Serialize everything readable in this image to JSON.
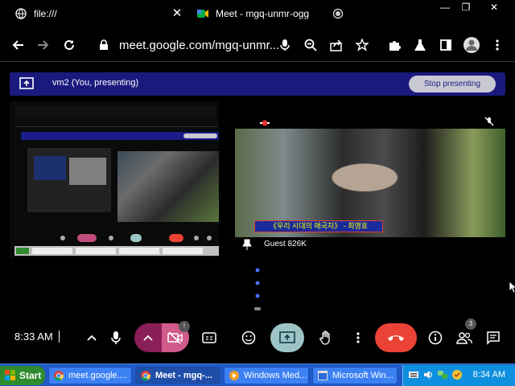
{
  "browser": {
    "tabs": [
      {
        "label": "file:///",
        "icon": "globe-icon"
      },
      {
        "label": "Meet - mgq-unmr-ogg",
        "icon": "meet-icon"
      }
    ],
    "address": "meet.google.com/mgq-unmr..."
  },
  "banner": {
    "text": "vm2 (You, presenting)",
    "stop_label": "Stop presenting"
  },
  "remote": {
    "caption": "《우리 시대의 애국자》 - 최영호",
    "name": "Guest 826K"
  },
  "controls": {
    "time": "8:33 AM",
    "camera_badge": "!",
    "people_badge": "3"
  },
  "taskbar": {
    "start": "Start",
    "tasks": [
      {
        "label": "meet.google....",
        "icon": "chrome-icon"
      },
      {
        "label": "Meet - mgq-...",
        "icon": "chrome-icon"
      },
      {
        "label": "Windows Med...",
        "icon": "media-player-icon"
      },
      {
        "label": "Microsoft Win...",
        "icon": "windows-icon"
      }
    ],
    "clock": "8:34 AM"
  },
  "colors": {
    "banner": "#1a1a7e",
    "hangup": "#ea4335",
    "camera_off": "#d05a8c",
    "present_active": "#9cc4c4",
    "taskbar": "#1f5ac8",
    "start": "#2e8b2e"
  }
}
